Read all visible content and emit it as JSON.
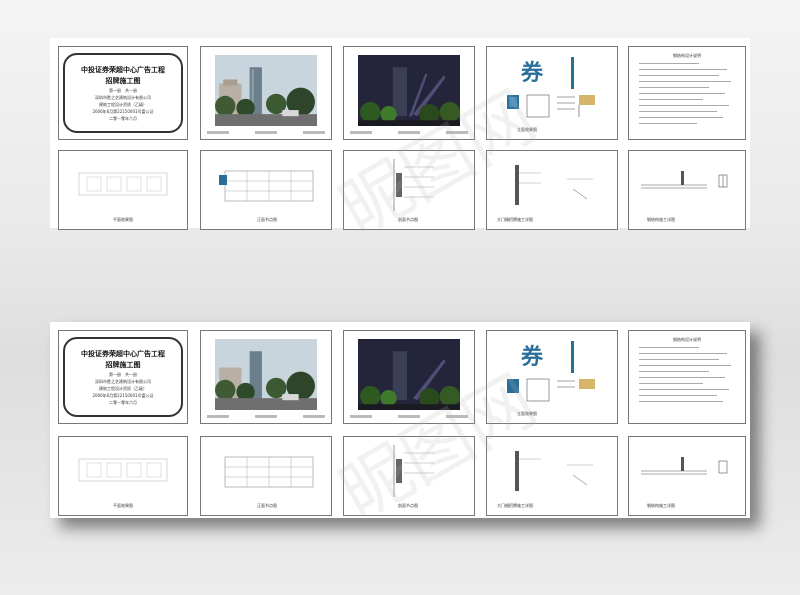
{
  "cover": {
    "title_line1": "中投证券荣超中心广告工程",
    "title_line2": "招牌施工图",
    "line1": "第一册　共一册",
    "line2": "深圳市胜之艺建筑设计有限公司",
    "line3": "建筑工程设计资质（乙级）",
    "line4": "2006年6月第22150001号富公证",
    "line5": "二零一零年六月"
  },
  "sign_char": "券",
  "drawing_titles": {
    "elevation": "立面效果图",
    "detail": "正面节点图",
    "section": "剖面节点图",
    "install": "大门楣招牌施工详图",
    "steel": "钢结构施工详图",
    "notes_title": "钢结构设计说明",
    "plan": "平面效果图"
  },
  "colors": {
    "sign_blue": "#2a6f9a",
    "night_sky": "#24243a",
    "day_sky": "#c9d5dc"
  }
}
